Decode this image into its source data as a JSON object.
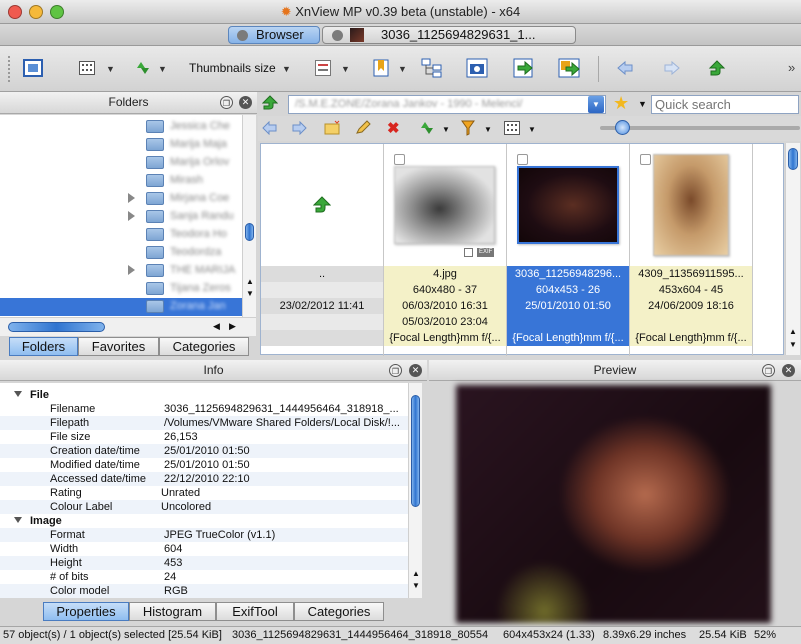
{
  "window": {
    "title": "XnView MP v0.39 beta (unstable) - x64",
    "tabs": [
      {
        "label": "Browser",
        "selected": true
      },
      {
        "label": "3036_1125694829631_1...",
        "selected": false
      }
    ]
  },
  "toolbar": {
    "thumbnails_size_label": "Thumbnails size"
  },
  "folders_panel": {
    "title": "Folders",
    "items": [
      {
        "label": "Jessica Che",
        "expandable": false
      },
      {
        "label": "Marija Maja",
        "expandable": false
      },
      {
        "label": "Marija Orlov",
        "expandable": false
      },
      {
        "label": "Mirash",
        "expandable": false
      },
      {
        "label": "Mirjana Coe",
        "expandable": true
      },
      {
        "label": "Sanja Randu",
        "expandable": true
      },
      {
        "label": "Teodora Ho",
        "expandable": false
      },
      {
        "label": "Teodordza",
        "expandable": false
      },
      {
        "label": "THE MARIJA",
        "expandable": true
      },
      {
        "label": "Tijana Zeros",
        "expandable": false
      },
      {
        "label": "Zorana Jan",
        "expandable": false,
        "selected": true
      }
    ],
    "bottom_tabs": [
      {
        "label": "Folders",
        "selected": true
      },
      {
        "label": "Favorites",
        "selected": false
      },
      {
        "label": "Categories",
        "selected": false
      }
    ]
  },
  "path_bar": {
    "path_value": "/S.M.E.ZONE/Zorana Jankov - 1990 - Melenci/",
    "search_placeholder": "Quick search"
  },
  "browser": {
    "parent_col": {
      "name": "..",
      "date": "23/02/2012 11:41"
    },
    "files": [
      {
        "name": "4.jpg",
        "dims": "640x480 - 37",
        "modified": "06/03/2010 16:31",
        "created": "05/03/2010 23:04",
        "exif": "{Focal Length}mm f/{...",
        "selected": false
      },
      {
        "name": "3036_11256948296...",
        "dims": "604x453 - 26",
        "modified": "25/01/2010 01:50",
        "created": "",
        "exif": "{Focal Length}mm f/{...",
        "selected": true
      },
      {
        "name": "4309_11356911595...",
        "dims": "453x604 - 45",
        "modified": "24/06/2009 18:16",
        "created": "",
        "exif": "{Focal Length}mm f/{...",
        "selected": false
      }
    ],
    "exif_badge": "EXIF"
  },
  "info_panel": {
    "title": "Info",
    "sections": [
      {
        "header": "File",
        "rows": [
          {
            "key": "Filename",
            "value": "3036_1125694829631_1444956464_318918_..."
          },
          {
            "key": "Filepath",
            "value": "/Volumes/VMware Shared Folders/Local Disk/!..."
          },
          {
            "key": "File size",
            "value": "26,153"
          },
          {
            "key": "Creation date/time",
            "value": "25/01/2010 01:50"
          },
          {
            "key": "Modified date/time",
            "value": "25/01/2010 01:50"
          },
          {
            "key": "Accessed date/time",
            "value": "22/12/2010 22:10"
          },
          {
            "key": "Rating",
            "value": "Unrated"
          },
          {
            "key": "Colour Label",
            "value": "Uncolored"
          }
        ]
      },
      {
        "header": "Image",
        "rows": [
          {
            "key": "Format",
            "value": "JPEG TrueColor (v1.1)"
          },
          {
            "key": "Width",
            "value": "604"
          },
          {
            "key": "Height",
            "value": "453"
          },
          {
            "key": "# of bits",
            "value": "24"
          },
          {
            "key": "Color model",
            "value": "RGB"
          }
        ]
      }
    ],
    "bottom_tabs": [
      {
        "label": "Properties",
        "selected": true
      },
      {
        "label": "Histogram",
        "selected": false
      },
      {
        "label": "ExifTool",
        "selected": false
      },
      {
        "label": "Categories",
        "selected": false
      }
    ]
  },
  "preview_panel": {
    "title": "Preview"
  },
  "status": {
    "selection": "57 object(s) / 1 object(s) selected [25.54 KiB]",
    "filename": "3036_1125694829631_1444956464_318918_80554",
    "dimensions": "604x453x24 (1.33)",
    "print_size": "8.39x6.29 inches",
    "size": "25.54 KiB",
    "zoom": "52%"
  },
  "colors": {
    "selection_blue": "#3875d7",
    "cell_yellow": "#f4f1c8"
  }
}
